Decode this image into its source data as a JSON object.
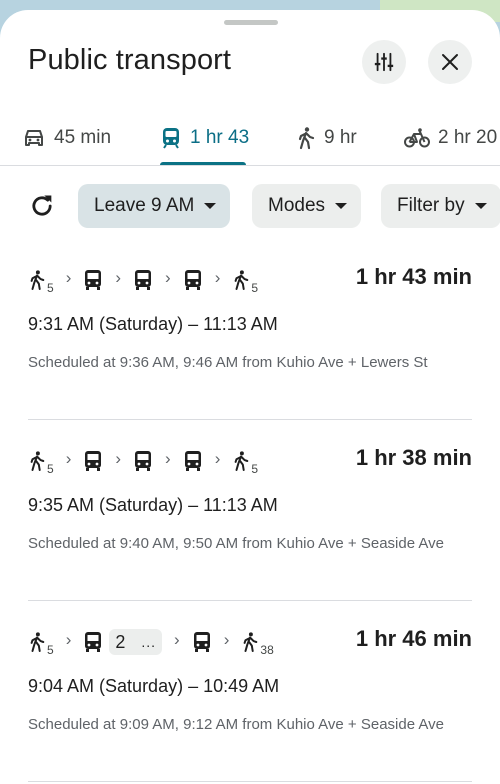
{
  "header": {
    "title": "Public transport"
  },
  "mode_tabs": [
    {
      "mode": "car-icon",
      "label": "45 min"
    },
    {
      "mode": "transit-icon",
      "label": "1 hr 43"
    },
    {
      "mode": "walk-icon",
      "label": "9 hr"
    },
    {
      "mode": "bike-icon",
      "label": "2 hr 20"
    }
  ],
  "filters": {
    "leave": "Leave 9 AM",
    "modes": "Modes",
    "filter_by": "Filter by"
  },
  "routes": [
    {
      "walk_start": "5",
      "walk_end": "5",
      "duration": "1 hr 43 min",
      "times": "9:31 AM (Saturday) – 11:13 AM",
      "schedule": "Scheduled at 9:36 AM, 9:46 AM from Kuhio Ave + Lewers St"
    },
    {
      "walk_start": "5",
      "walk_end": "5",
      "duration": "1 hr 38 min",
      "times": "9:35 AM (Saturday) – 11:13 AM",
      "schedule": "Scheduled at 9:40 AM, 9:50 AM from Kuhio Ave + Seaside Ave"
    },
    {
      "walk_start": "5",
      "walk_end": "38",
      "bus_option_count": "2",
      "bus_more": "...",
      "duration": "1 hr 46 min",
      "times": "9:04 AM (Saturday) – 10:49 AM",
      "schedule": "Scheduled at 9:09 AM, 9:12 AM from Kuhio Ave + Seaside Ave"
    }
  ],
  "colors": {
    "accent": "#0b7285",
    "chip_selected": "#d9e3e6",
    "chip": "#eceeed"
  }
}
